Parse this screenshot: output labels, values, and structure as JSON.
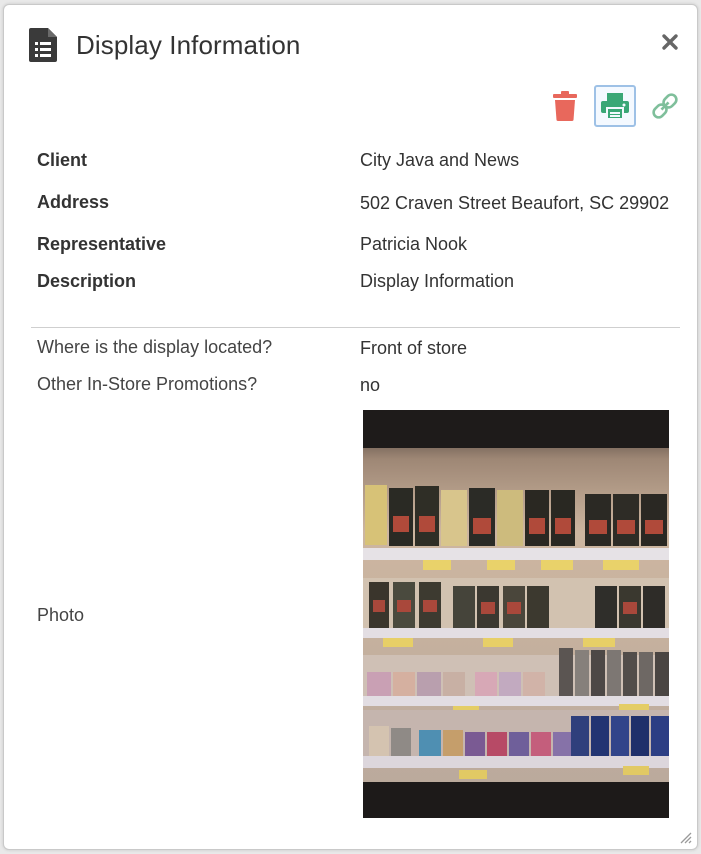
{
  "dialog": {
    "title": "Display Information",
    "icons": {
      "title": "document-list-icon",
      "close": "close-icon",
      "resize": "resize-grip-icon"
    }
  },
  "toolbar": {
    "buttons": [
      {
        "name": "delete",
        "icon": "trash-icon",
        "color": "#e8685c"
      },
      {
        "name": "print",
        "icon": "printer-icon",
        "color": "#3aa776",
        "active": true
      },
      {
        "name": "link",
        "icon": "link-icon",
        "color": "#7fbf9b"
      }
    ]
  },
  "details": [
    {
      "label": "Client",
      "value": "City Java and News"
    },
    {
      "label": "Address",
      "value": "502 Craven Street Beaufort, SC 29902"
    },
    {
      "label": "Representative",
      "value": "Patricia Nook"
    },
    {
      "label": "Description",
      "value": "Display Information"
    }
  ],
  "answers": [
    {
      "label": "Where is the display located?",
      "value": "Front of store"
    },
    {
      "label": "Other In-Store Promotions?",
      "value": "no"
    }
  ],
  "photo": {
    "label": "Photo",
    "subject": "store-display-shelf-photo"
  },
  "colors": {
    "text": "#333333",
    "active_border": "#9ec1e6",
    "divider": "#cfcfcf"
  }
}
